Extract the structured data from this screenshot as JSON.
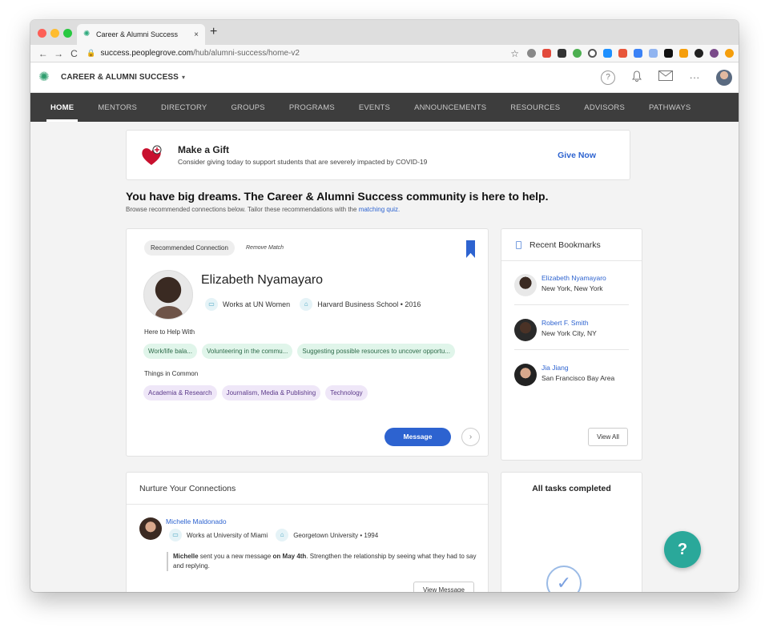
{
  "browser": {
    "tab_title": "Career & Alumni Success",
    "tab_close": "×",
    "new_tab": "+",
    "url_host": "success.peoplegrove.com",
    "url_path": "/hub/alumni-success/home-v2",
    "back": "←",
    "forward": "→",
    "reload": "C",
    "lock": "🔒",
    "star": "☆"
  },
  "header": {
    "org_name": "CAREER & ALUMNI SUCCESS",
    "org_caret": "▾",
    "help_glyph": "?",
    "bell_glyph": "🔔",
    "more_glyph": "···",
    "user_caret": "▾"
  },
  "nav": {
    "items": [
      "HOME",
      "MENTORS",
      "DIRECTORY",
      "GROUPS",
      "PROGRAMS",
      "EVENTS",
      "ANNOUNCEMENTS",
      "RESOURCES",
      "ADVISORS",
      "PATHWAYS"
    ],
    "active": "HOME"
  },
  "gift": {
    "title": "Make a Gift",
    "subtitle": "Consider giving today to support students that are severely impacted by COVID-19",
    "cta": "Give Now"
  },
  "hero": {
    "title": "You have big dreams. The Career & Alumni Success community is here to help.",
    "subtitle_prefix": "Browse recommended connections below. Tailor these recommendations with the",
    "quiz_link": "matching quiz."
  },
  "recommendation": {
    "tag": "Recommended Connection",
    "remove": "Remove Match",
    "name": "Elizabeth Nyamayaro",
    "work": "Works at UN Women",
    "school": "Harvard Business School • 2016",
    "help_label": "Here to Help With",
    "help_chips": [
      "Work/life bala...",
      "Volunteering in the commu...",
      "Suggesting possible resources to uncover opportu..."
    ],
    "common_label": "Things in Common",
    "common_chips": [
      "Academia & Research",
      "Journalism, Media & Publishing",
      "Technology"
    ],
    "message_button": "Message",
    "next_glyph": "›"
  },
  "bookmarks": {
    "title": "Recent Bookmarks",
    "items": [
      {
        "name": "Elizabeth Nyamayaro",
        "location": "New York, New York"
      },
      {
        "name": "Robert F. Smith",
        "location": "New York City, NY"
      },
      {
        "name": "Jia Jiang",
        "location": "San Francisco Bay Area"
      }
    ],
    "view_all": "View All"
  },
  "nurture": {
    "title": "Nurture Your Connections",
    "name": "Michelle Maldonado",
    "work": "Works at University of Miami",
    "school": "Georgetown University • 1994",
    "msg_name": "Michelle",
    "msg_mid": " sent you a new message ",
    "msg_date": "on May 4th",
    "msg_rest": ". Strengthen the relationship by seeing what they had to say and replying.",
    "view_message": "View Message"
  },
  "tasks": {
    "title": "All tasks completed",
    "check_glyph": "✓"
  },
  "fab": {
    "label": "?"
  },
  "colors": {
    "accent_blue": "#2d63d0",
    "nav_bg": "#3d3d3d",
    "chip_green": "#e0f5ea",
    "chip_purple": "#efe7f8",
    "fab_teal": "#2aa89a"
  }
}
